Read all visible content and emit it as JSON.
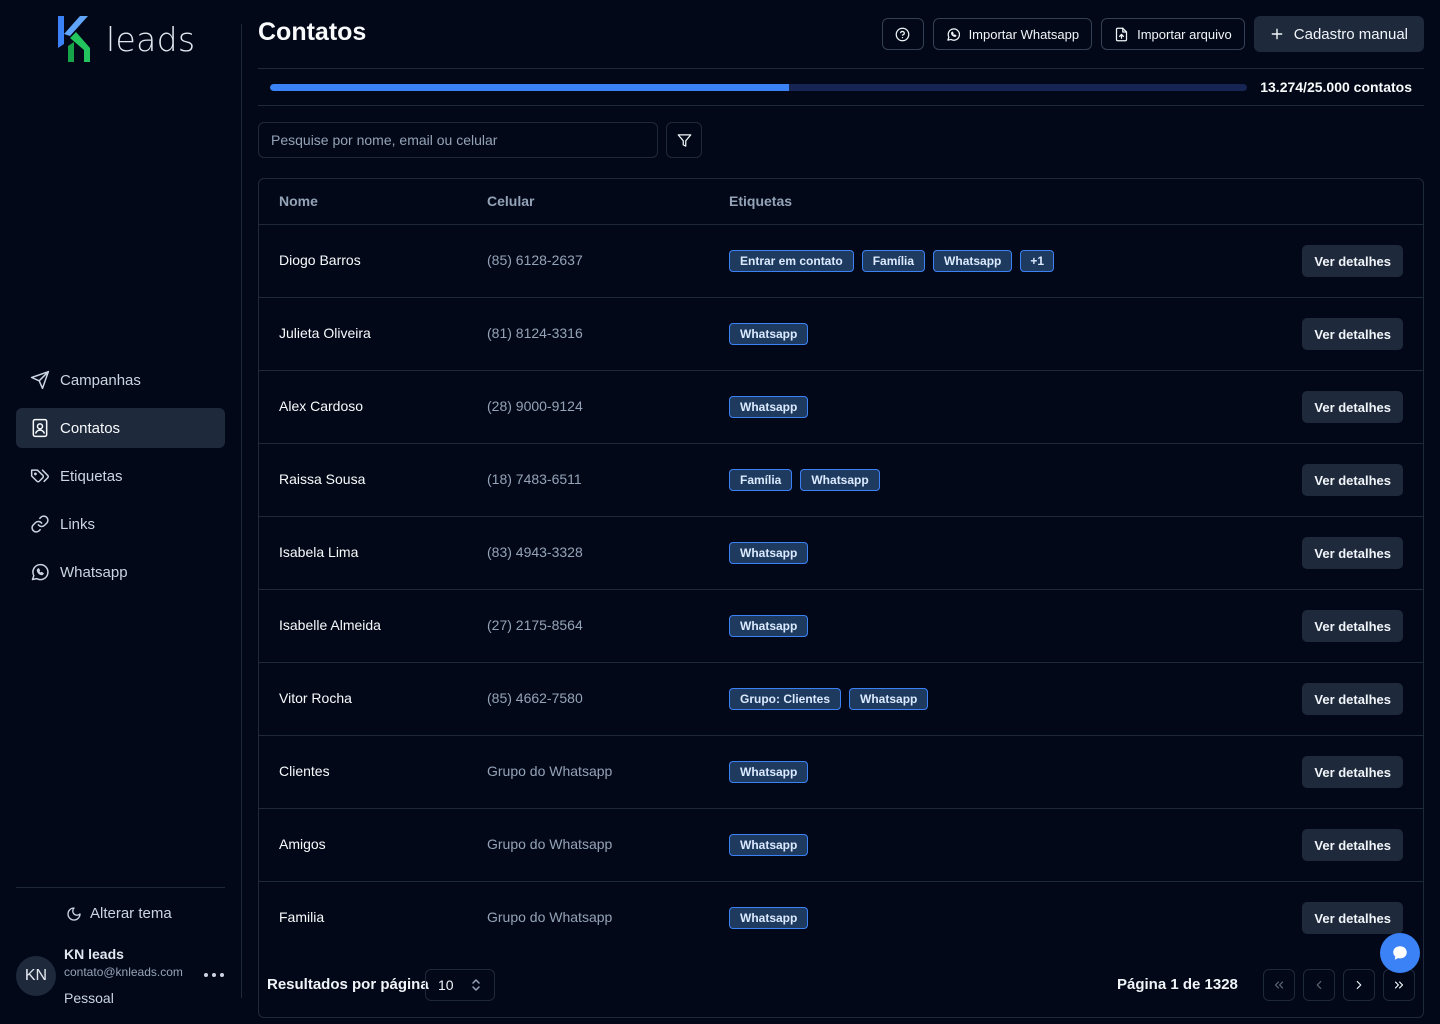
{
  "app": {
    "logo_text": "leads"
  },
  "sidebar": {
    "items": [
      {
        "label": "Campanhas",
        "icon": "send-icon",
        "active": false
      },
      {
        "label": "Contatos",
        "icon": "contact-book-icon",
        "active": true
      },
      {
        "label": "Etiquetas",
        "icon": "tags-icon",
        "active": false
      },
      {
        "label": "Links",
        "icon": "link-icon",
        "active": false
      },
      {
        "label": "Whatsapp",
        "icon": "whatsapp-icon",
        "active": false
      }
    ],
    "theme_toggle_label": "Alterar tema",
    "user": {
      "initials": "KN",
      "name": "KN leads",
      "email": "contato@knleads.com",
      "plan": "Pessoal"
    }
  },
  "header": {
    "title": "Contatos",
    "import_whatsapp_label": "Importar Whatsapp",
    "import_file_label": "Importar arquivo",
    "manual_register_label": "Cadastro manual"
  },
  "quota": {
    "used": 13274,
    "total": 25000,
    "fraction": 0.531,
    "label": "13.274/25.000 contatos"
  },
  "search": {
    "placeholder": "Pesquise por nome, email ou celular",
    "value": ""
  },
  "table": {
    "headers": {
      "name": "Nome",
      "phone": "Celular",
      "tags": "Etiquetas"
    },
    "details_label": "Ver detalhes",
    "rows": [
      {
        "name": "Diogo Barros",
        "phone": "(85) 6128-2637",
        "tags": [
          "Entrar em contato",
          "Família",
          "Whatsapp",
          "+1"
        ]
      },
      {
        "name": "Julieta Oliveira",
        "phone": "(81) 8124-3316",
        "tags": [
          "Whatsapp"
        ]
      },
      {
        "name": "Alex Cardoso",
        "phone": "(28) 9000-9124",
        "tags": [
          "Whatsapp"
        ]
      },
      {
        "name": "Raissa Sousa",
        "phone": "(18) 7483-6511",
        "tags": [
          "Família",
          "Whatsapp"
        ]
      },
      {
        "name": "Isabela Lima",
        "phone": "(83) 4943-3328",
        "tags": [
          "Whatsapp"
        ]
      },
      {
        "name": "Isabelle Almeida",
        "phone": "(27) 2175-8564",
        "tags": [
          "Whatsapp"
        ]
      },
      {
        "name": "Vitor Rocha",
        "phone": "(85) 4662-7580",
        "tags": [
          "Grupo: Clientes",
          "Whatsapp"
        ]
      },
      {
        "name": "Clientes",
        "phone": "Grupo do Whatsapp",
        "tags": [
          "Whatsapp"
        ]
      },
      {
        "name": "Amigos",
        "phone": "Grupo do Whatsapp",
        "tags": [
          "Whatsapp"
        ]
      },
      {
        "name": "Familia",
        "phone": "Grupo do Whatsapp",
        "tags": [
          "Whatsapp"
        ]
      }
    ]
  },
  "pagination": {
    "per_page_label": "Resultados por página",
    "per_page_value": "10",
    "page_info": "Página 1 de 1328"
  },
  "colors": {
    "background": "#020817",
    "accent": "#3b82f6",
    "surface": "#1e293b",
    "tag_bg": "#1e3a5f"
  }
}
